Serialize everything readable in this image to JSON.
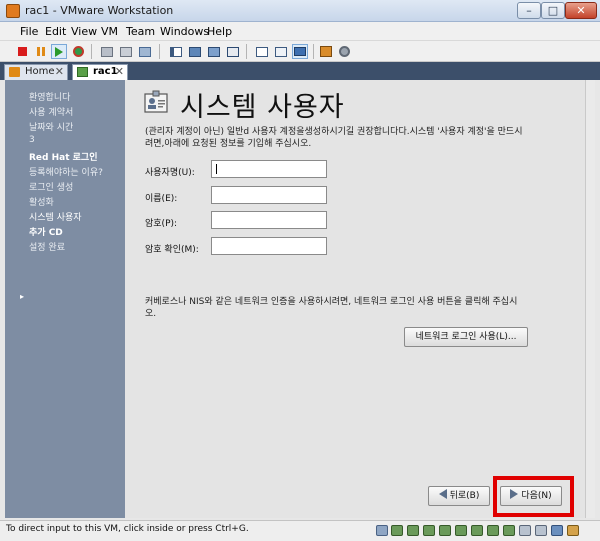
{
  "window": {
    "title": "rac1 - VMware Workstation",
    "min_glyph": "–",
    "max_glyph": "□",
    "close_glyph": "✕"
  },
  "menu": [
    "File",
    "Edit",
    "View",
    "VM",
    "Team",
    "Windows",
    "Help"
  ],
  "tabs": [
    {
      "label": "Home",
      "close": "✕"
    },
    {
      "label": "rac1",
      "close": "✕"
    }
  ],
  "sidebar": {
    "items": [
      "환영합니다",
      "사용 계약서",
      "날짜와 시간",
      "3",
      "Red Hat 로그인",
      "등록해야하는 이유?",
      "로그인 생성",
      "활성화",
      "시스템 사용자",
      "추가 CD",
      "설정 완료"
    ],
    "active_arrow": "▸"
  },
  "page": {
    "heading": "시스템 사용자",
    "intro": "(관리자 계정이 아닌) 일반d 사용자 계정을생성하시기길 권장합니다다.시스템 '사용자 계정'을 만드시려면,아래에 요청된 정보를 기입해 주십시오.",
    "fields": [
      {
        "label": "사용자명(U):",
        "value": ""
      },
      {
        "label": "이름(E):",
        "value": ""
      },
      {
        "label": "암호(P):",
        "value": ""
      },
      {
        "label": "암호 확인(M):",
        "value": ""
      }
    ],
    "nis_text": "커베로스나 NIS와 같은 네트워크 인증을 사용하시려면, 네트워크 로그인 사용 버튼을 클릭해 주십시오.",
    "network_login_button": "네트워크 로그인 사용(L)...",
    "back_button": "뒤로(B)",
    "next_button": "다음(N)"
  },
  "status": {
    "text": "To direct input to this VM, click inside or press Ctrl+G."
  },
  "colors": {
    "sidebar": "#7e8da3",
    "tabstrip": "#3c4f6a",
    "highlight": "#e00000"
  }
}
